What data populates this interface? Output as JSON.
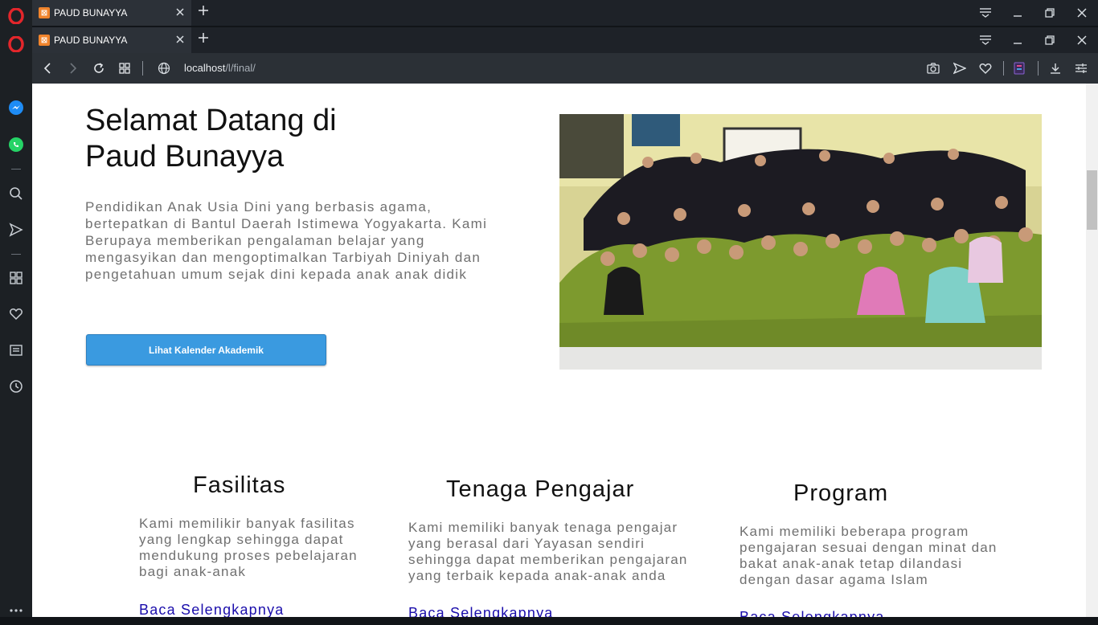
{
  "browser": {
    "tabs": [
      {
        "title": "PAUD BUNAYYA"
      },
      {
        "title": "PAUD BUNAYYA"
      }
    ],
    "url_host": "localhost",
    "url_path": "/l/final/"
  },
  "hero": {
    "title_line1": "Selamat Datang di",
    "title_line2": "Paud Bunayya",
    "description": "Pendidikan Anak Usia Dini yang berbasis agama, bertepatkan di Bantul Daerah Istimewa Yogyakarta. Kami Berupaya memberikan pengalaman belajar yang mengasyikan dan mengoptimalkan Tarbiyah Diniyah dan pengetahuan umum sejak dini kepada anak anak didik",
    "button_label": "Lihat Kalender Akademik"
  },
  "features": [
    {
      "title": "Fasilitas",
      "text": "Kami memilikir banyak fasilitas yang lengkap sehingga dapat mendukung proses pebelajaran bagi anak-anak",
      "link": "Baca Selengkapnya"
    },
    {
      "title": "Tenaga Pengajar",
      "text": "Kami memiliki banyak tenaga pengajar yang berasal dari Yayasan sendiri sehingga dapat memberikan pengajaran yang terbaik kepada anak-anak anda",
      "link": "Baca Selengkapnya"
    },
    {
      "title": "Program",
      "text": "Kami memiliki beberapa program pengajaran sesuai dengan minat dan bakat anak-anak tetap dilandasi dengan dasar agama Islam",
      "link": "Baca Selengkapnya"
    }
  ],
  "colors": {
    "accent": "#3a9ae0",
    "link": "#1a0dab"
  }
}
